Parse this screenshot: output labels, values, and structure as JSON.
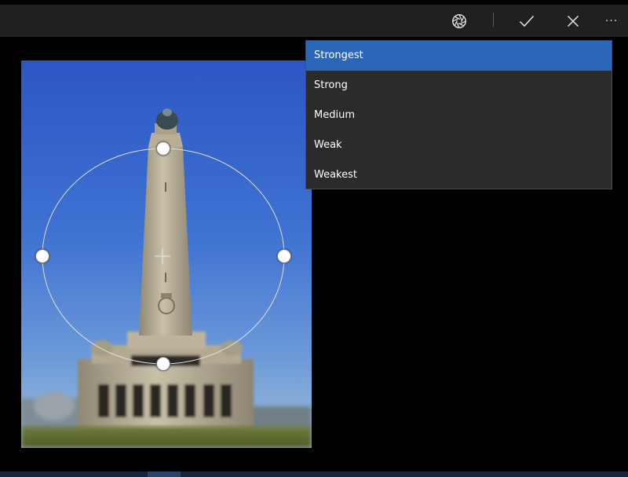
{
  "toolbar": {
    "buttons": [
      {
        "name": "vignette-focus-button",
        "icon": "aperture-icon"
      },
      {
        "name": "apply-button",
        "icon": "checkmark-icon"
      },
      {
        "name": "cancel-button",
        "icon": "close-icon"
      },
      {
        "name": "more-button",
        "icon": "more-icon"
      }
    ],
    "more_label": "···"
  },
  "blur_strength": {
    "selected": "Strongest",
    "options": [
      "Strongest",
      "Strong",
      "Medium",
      "Weak",
      "Weakest"
    ]
  },
  "photo": {
    "subject": "monument-tower",
    "focus_selection": "circle"
  },
  "colors": {
    "toolbar_bg": "#202020",
    "menu_bg": "#2b2b2b",
    "selected_item": "#2c66b8",
    "text": "#ffffff"
  }
}
